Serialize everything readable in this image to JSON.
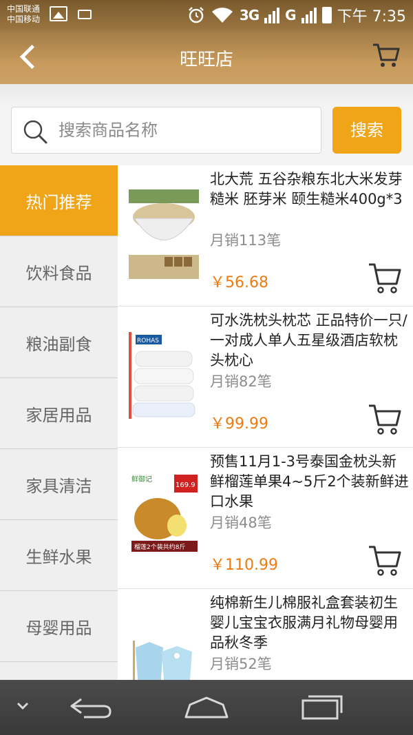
{
  "status_bar": {
    "carrier_1": "中国联通",
    "carrier_2": "中国移动",
    "sig1": "3G",
    "sig2": "G",
    "time": "下午 7:35"
  },
  "header": {
    "title": "旺旺店",
    "back_icon": "back-arrow-icon",
    "cart_icon": "cart-icon"
  },
  "search": {
    "placeholder": "搜索商品名称",
    "button_label": "搜索"
  },
  "colors": {
    "accent": "#f0a418",
    "price": "#ee7a12",
    "header": "#c79a5c"
  },
  "sidebar": {
    "items": [
      {
        "label": "热门推荐",
        "active": true
      },
      {
        "label": "饮料食品",
        "active": false
      },
      {
        "label": "粮油副食",
        "active": false
      },
      {
        "label": "家居用品",
        "active": false
      },
      {
        "label": "家具清洁",
        "active": false
      },
      {
        "label": "生鲜水果",
        "active": false
      },
      {
        "label": "母婴用品",
        "active": false
      }
    ]
  },
  "products": [
    {
      "title": "北大荒 五谷杂粮东北大米发芽糙米 胚芽米 颐生糙米400g*3",
      "sales": "月销113笔",
      "price": "￥56.68"
    },
    {
      "title": "可水洗枕头枕芯 正品特价一只/一对成人单人五星级酒店软枕头枕心",
      "sales": "月销82笔",
      "price": "￥99.99",
      "image_text": "ROHAS"
    },
    {
      "title": "预售11月1-3号泰国金枕头新鲜榴莲单果4~5斤2个装新鲜进口水果",
      "sales": "月销48笔",
      "price": "￥110.99",
      "image_text": "鲜御记",
      "image_price": "169.9",
      "image_caption": "榴莲2个装共约8斤"
    },
    {
      "title": "纯棉新生儿棉服礼盒套装初生婴儿宝宝衣服满月礼物母婴用品秋冬季",
      "sales": "月销52笔",
      "price": ""
    }
  ],
  "nav_bar": {
    "icons": [
      "chevron-down-icon",
      "back-nav-icon",
      "home-icon",
      "recent-apps-icon"
    ]
  }
}
